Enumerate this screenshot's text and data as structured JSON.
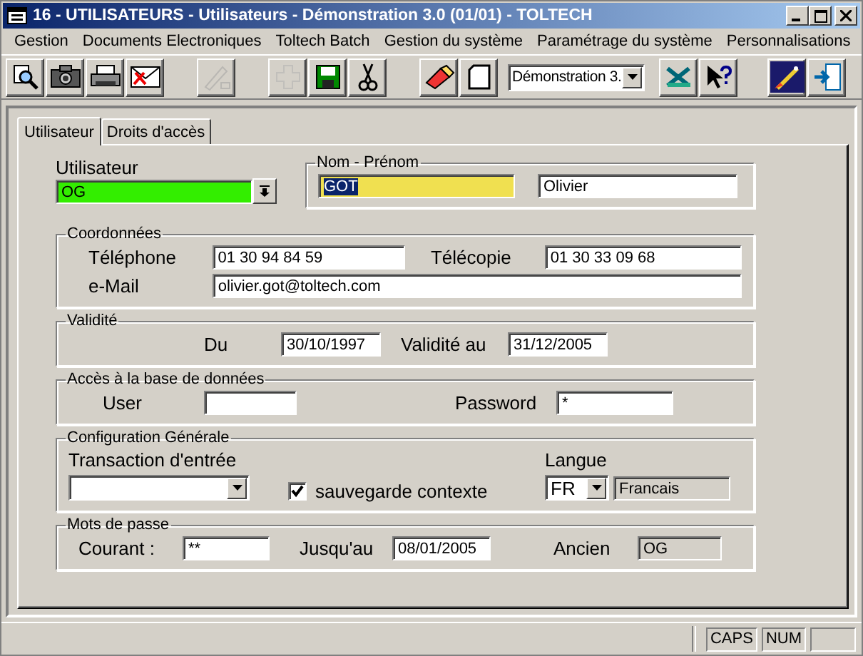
{
  "window": {
    "title": "16 - UTILISATEURS - Utilisateurs - Démonstration 3.0 (01/01) - TOLTECH"
  },
  "menu": [
    "Gestion",
    "Documents Electroniques",
    "Toltech Batch",
    "Gestion du système",
    "Paramétrage du système",
    "Personnalisations"
  ],
  "toolbar": {
    "buttons_left": [
      {
        "disabled": false
      },
      {
        "disabled": false
      },
      {
        "disabled": false
      },
      {
        "disabled": false
      },
      {
        "disabled": true
      },
      {
        "disabled": true
      },
      {
        "disabled": false
      },
      {
        "disabled": false
      },
      {
        "disabled": false
      },
      {
        "disabled": false
      }
    ],
    "combo": {
      "value": "Démonstration 3."
    },
    "buttons_right": [
      {
        "disabled": false
      },
      {
        "disabled": false
      },
      {
        "disabled": false
      },
      {
        "disabled": false
      }
    ]
  },
  "tabs": [
    {
      "label": "Utilisateur",
      "selected": true
    },
    {
      "label": "Droits d'accès",
      "selected": false
    }
  ],
  "user": {
    "label": "Utilisateur",
    "value": "OG"
  },
  "name_group": {
    "title": "Nom - Prénom",
    "last_name": {
      "value": "GOT",
      "highlighted": true
    },
    "first_name": "Olivier"
  },
  "contact": {
    "title": "Coordonnées",
    "phone_label": "Téléphone",
    "phone": "01 30 94 84 59",
    "fax_label": "Télécopie",
    "fax": "01 30 33 09 68",
    "email_label": "e-Mail",
    "email": "olivier.got@toltech.com"
  },
  "validity": {
    "title": "Validité",
    "from_label": "Du",
    "from": "30/10/1997",
    "to_label": "Validité au",
    "to": "31/12/2005"
  },
  "database": {
    "title": "Accès à la base de données",
    "user_label": "User",
    "password_label": "Password",
    "password": "*"
  },
  "config": {
    "title": "Configuration Générale",
    "transaction_label": "Transaction d'entrée",
    "save_context": {
      "label": "sauvegarde contexte",
      "checked": true
    },
    "language_label": "Langue",
    "language_code": "FR",
    "language_name": "Francais"
  },
  "passwords": {
    "title": "Mots de passe",
    "current_label": "Courant :",
    "current": "**",
    "until_label": "Jusqu'au",
    "until": "08/01/2005",
    "previous_label": "Ancien",
    "previous": "OG"
  },
  "status_bar": [
    "CAPS",
    "NUM"
  ]
}
